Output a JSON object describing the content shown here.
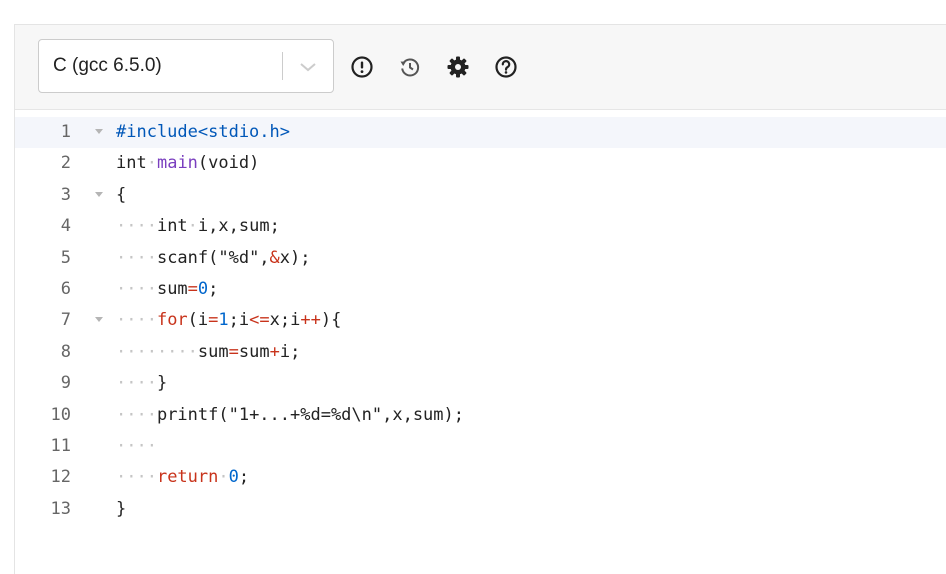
{
  "toolbar": {
    "language_value": "C (gcc 6.5.0)",
    "icons": [
      "exclamation-circle-icon",
      "history-icon",
      "gear-icon",
      "question-circle-icon"
    ]
  },
  "colors": {
    "keyword": "#c8331b",
    "function": "#7a3fbf",
    "number": "#0066cc",
    "preprocessor": "#0057b8",
    "whitespace_marker": "#c5c5c5",
    "line_number": "#666666"
  },
  "editor": {
    "lines": [
      {
        "num": "1",
        "fold": true,
        "segments": [
          {
            "t": "#include<stdio.h>",
            "c": "pp"
          }
        ]
      },
      {
        "num": "2",
        "fold": false,
        "segments": [
          {
            "t": "int",
            "c": "plain"
          },
          {
            "t": "·",
            "c": "ws"
          },
          {
            "t": "main",
            "c": "fn"
          },
          {
            "t": "(void)",
            "c": "plain"
          }
        ]
      },
      {
        "num": "3",
        "fold": true,
        "segments": [
          {
            "t": "{",
            "c": "plain"
          }
        ]
      },
      {
        "num": "4",
        "fold": false,
        "segments": [
          {
            "t": "····",
            "c": "ws"
          },
          {
            "t": "int",
            "c": "plain"
          },
          {
            "t": "·",
            "c": "ws"
          },
          {
            "t": "i,x,sum;",
            "c": "plain"
          }
        ]
      },
      {
        "num": "5",
        "fold": false,
        "segments": [
          {
            "t": "····",
            "c": "ws"
          },
          {
            "t": "scanf(\"%d\",",
            "c": "plain"
          },
          {
            "t": "&",
            "c": "op"
          },
          {
            "t": "x);",
            "c": "plain"
          }
        ]
      },
      {
        "num": "6",
        "fold": false,
        "segments": [
          {
            "t": "····",
            "c": "ws"
          },
          {
            "t": "sum",
            "c": "plain"
          },
          {
            "t": "=",
            "c": "op"
          },
          {
            "t": "0",
            "c": "num"
          },
          {
            "t": ";",
            "c": "plain"
          }
        ]
      },
      {
        "num": "7",
        "fold": true,
        "segments": [
          {
            "t": "····",
            "c": "ws"
          },
          {
            "t": "for",
            "c": "kw"
          },
          {
            "t": "(i",
            "c": "plain"
          },
          {
            "t": "=",
            "c": "op"
          },
          {
            "t": "1",
            "c": "num"
          },
          {
            "t": ";i",
            "c": "plain"
          },
          {
            "t": "<=",
            "c": "op"
          },
          {
            "t": "x;i",
            "c": "plain"
          },
          {
            "t": "++",
            "c": "op"
          },
          {
            "t": "){",
            "c": "plain"
          }
        ]
      },
      {
        "num": "8",
        "fold": false,
        "segments": [
          {
            "t": "········",
            "c": "ws"
          },
          {
            "t": "sum",
            "c": "plain"
          },
          {
            "t": "=",
            "c": "op"
          },
          {
            "t": "sum",
            "c": "plain"
          },
          {
            "t": "+",
            "c": "op"
          },
          {
            "t": "i;",
            "c": "plain"
          }
        ]
      },
      {
        "num": "9",
        "fold": false,
        "segments": [
          {
            "t": "····",
            "c": "ws"
          },
          {
            "t": "}",
            "c": "plain"
          }
        ]
      },
      {
        "num": "10",
        "fold": false,
        "segments": [
          {
            "t": "····",
            "c": "ws"
          },
          {
            "t": "printf(\"1+...+%d=%d\\n\",x,sum);",
            "c": "plain"
          }
        ]
      },
      {
        "num": "11",
        "fold": false,
        "segments": [
          {
            "t": "····",
            "c": "ws"
          }
        ]
      },
      {
        "num": "12",
        "fold": false,
        "segments": [
          {
            "t": "····",
            "c": "ws"
          },
          {
            "t": "return",
            "c": "kw"
          },
          {
            "t": "·",
            "c": "ws"
          },
          {
            "t": "0",
            "c": "num"
          },
          {
            "t": ";",
            "c": "plain"
          }
        ]
      },
      {
        "num": "13",
        "fold": false,
        "segments": [
          {
            "t": "}",
            "c": "plain"
          }
        ]
      }
    ]
  }
}
